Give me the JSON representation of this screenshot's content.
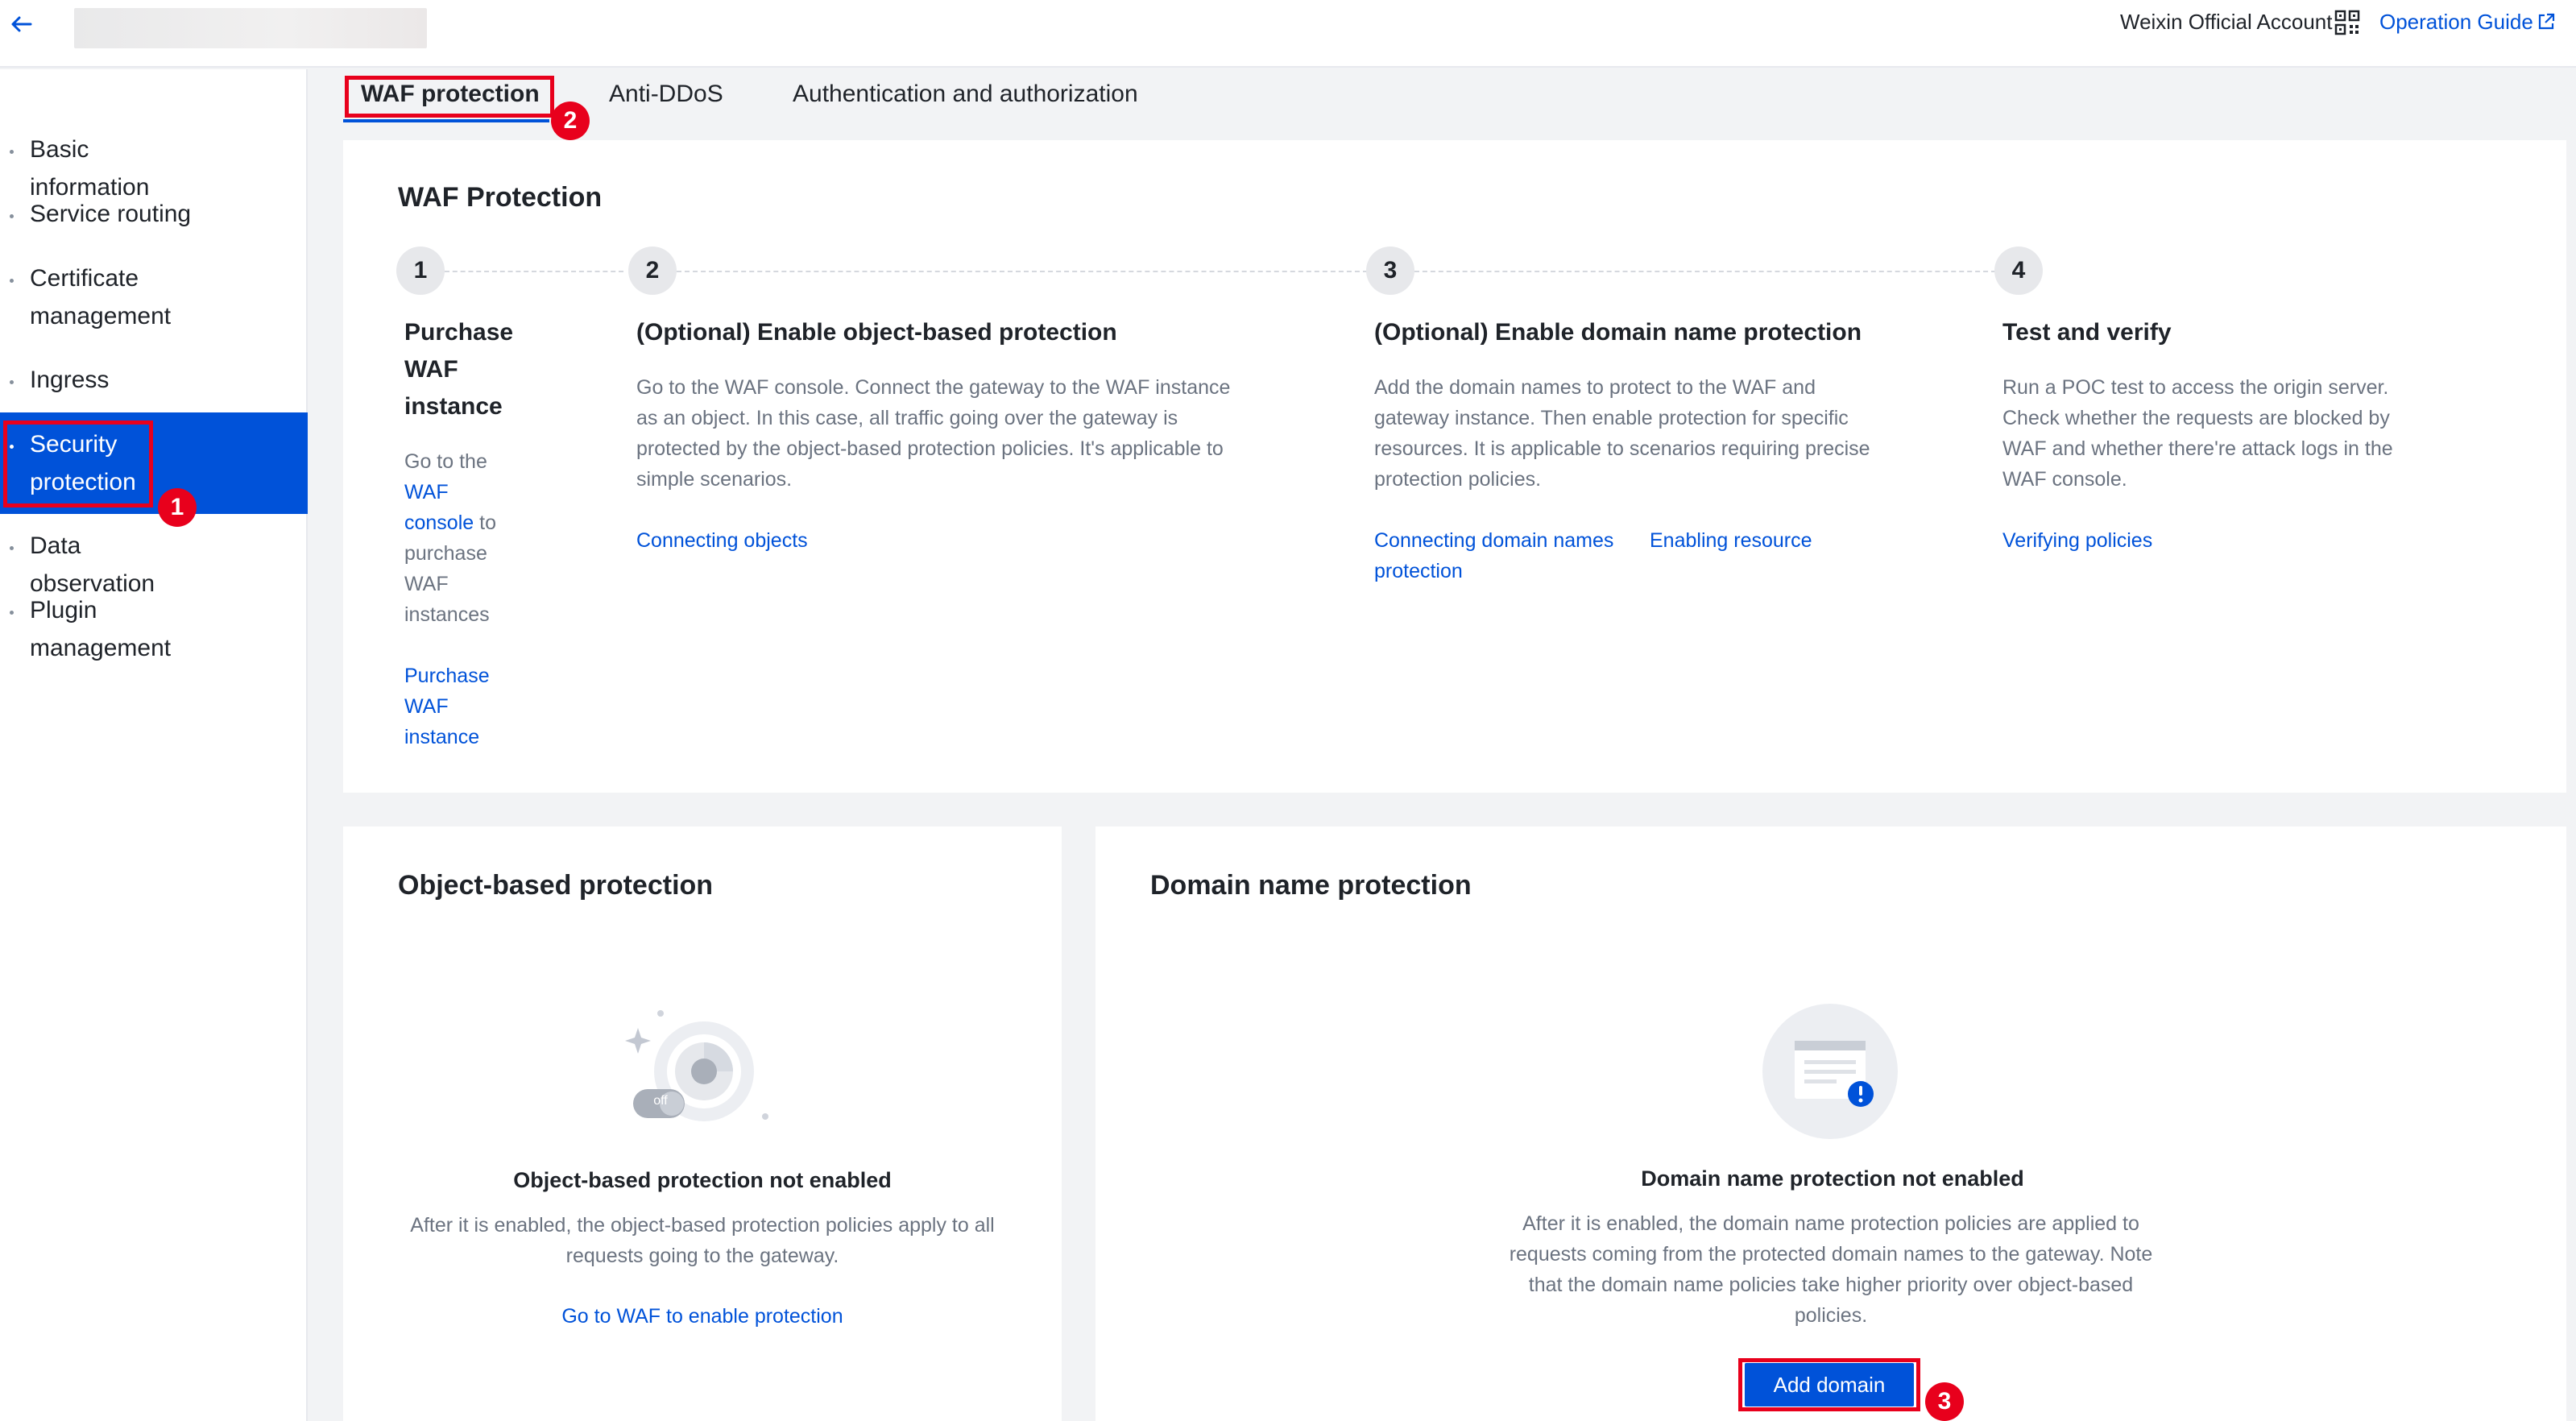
{
  "header": {
    "account_label": "Weixin Official Account",
    "guide_label": "Operation Guide"
  },
  "sidebar": {
    "items": [
      {
        "label": "Basic information"
      },
      {
        "label": "Service routing"
      },
      {
        "label": "Certificate management"
      },
      {
        "label": "Ingress"
      },
      {
        "label": "Security protection"
      },
      {
        "label": "Data observation"
      },
      {
        "label": "Plugin management"
      }
    ]
  },
  "tabs": [
    {
      "label": "WAF protection"
    },
    {
      "label": "Anti-DDoS"
    },
    {
      "label": "Authentication and authorization"
    }
  ],
  "waf": {
    "title": "WAF Protection",
    "steps": [
      {
        "number": "1",
        "title": "Purchase WAF instance",
        "desc_before": "Go to the ",
        "desc_link": "WAF console",
        "desc_after": " to purchase WAF instances",
        "links": [
          "Purchase WAF instance"
        ]
      },
      {
        "number": "2",
        "title": "(Optional) Enable object-based protection",
        "desc": "Go to the WAF console. Connect the gateway to the WAF instance as an object. In this case, all traffic going over the gateway is protected by the object-based protection policies. It's applicable to simple scenarios.",
        "links": [
          "Connecting objects"
        ]
      },
      {
        "number": "3",
        "title": "(Optional) Enable domain name protection",
        "desc": "Add the domain names to protect to the WAF and gateway instance. Then enable protection for specific resources. It is applicable to scenarios requiring precise protection policies.",
        "links": [
          "Connecting domain names",
          "Enabling resource protection"
        ]
      },
      {
        "number": "4",
        "title": "Test and verify",
        "desc": "Run a POC test to access the origin server. Check whether the requests are blocked by WAF and whether there're attack logs in the WAF console.",
        "links": [
          "Verifying policies"
        ]
      }
    ]
  },
  "object_protection": {
    "title": "Object-based protection",
    "toggle_text": "off",
    "empty_title": "Object-based protection not enabled",
    "empty_desc": "After it is enabled, the object-based protection policies apply to all requests going to the gateway.",
    "action_link": "Go to WAF to enable protection"
  },
  "domain_protection": {
    "title": "Domain name protection",
    "empty_title": "Domain name protection not enabled",
    "empty_desc": "After it is enabled, the domain name protection policies are applied to requests coming from the protected domain names to the gateway. Note that the domain name policies take higher priority over object-based policies.",
    "add_button": "Add domain"
  },
  "annotations": [
    "1",
    "2",
    "3"
  ],
  "colors": {
    "primary": "#0052d9",
    "annotation_red": "#e8001c",
    "page_bg": "#f2f3f5"
  },
  "icons": [
    "back-arrow-icon",
    "qr-code-icon",
    "external-link-icon",
    "shield-off-icon",
    "document-warning-icon"
  ]
}
